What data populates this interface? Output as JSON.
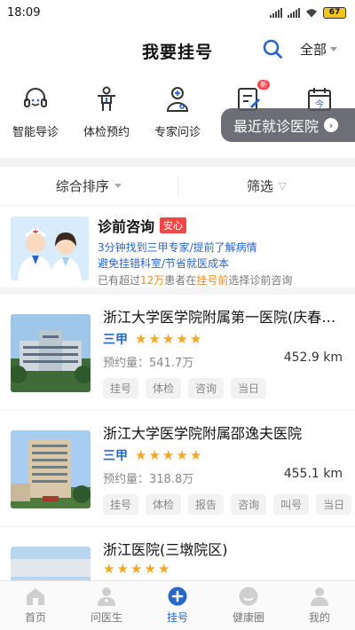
{
  "status_bar": {
    "time": "18:09",
    "battery": "67"
  },
  "header": {
    "title": "我要挂号",
    "city": "全部"
  },
  "quick_entries": [
    {
      "label": "智能导诊",
      "icon": "headset-icon"
    },
    {
      "label": "体检预约",
      "icon": "person-icon"
    },
    {
      "label": "专家问诊",
      "icon": "doctor-stethoscope-icon"
    },
    {
      "label": "",
      "icon": "clipboard-edit-icon",
      "badge": "新"
    },
    {
      "label": "",
      "icon": "calendar-icon",
      "icon_text": "今"
    }
  ],
  "recent_hospital_label": "最近就诊医院",
  "recent_hospital_arrow": "›",
  "sort_bar": {
    "sort_label": "综合排序",
    "filter_label": "筛选",
    "filter_icon": "▽"
  },
  "consult_card": {
    "title": "诊前咨询",
    "tag": "安心",
    "line1": "3分钟找到三甲专家/提前了解病情",
    "line2": "避免挂错科室/节省就医成本",
    "note_prefix": "已有超过",
    "note_count": "12万",
    "note_mid": "患者在",
    "note_highlight": "挂号前",
    "note_suffix": "选择诊前咨询"
  },
  "hospitals": [
    {
      "name": "浙江大学医学院附属第一医院(庆春院区)",
      "level": "三甲",
      "rating_stars": 5,
      "volume": "预约量：541.7万",
      "distance": "452.9 km",
      "tags": [
        "挂号",
        "体检",
        "咨询",
        "当日"
      ]
    },
    {
      "name": "浙江大学医学院附属邵逸夫医院",
      "level": "三甲",
      "rating_stars": 5,
      "volume": "预约量：318.8万",
      "distance": "455.1 km",
      "tags": [
        "挂号",
        "体检",
        "报告",
        "咨询",
        "叫号",
        "当日"
      ]
    },
    {
      "name": "浙江医院(三墩院区)",
      "level": "",
      "rating_stars": 5,
      "volume": "",
      "distance": "",
      "tags": []
    }
  ],
  "bottom_nav": [
    {
      "label": "首页",
      "icon": "home-icon",
      "active": false
    },
    {
      "label": "问医生",
      "icon": "doctor-icon",
      "active": false
    },
    {
      "label": "挂号",
      "icon": "plus-circle-icon",
      "active": true
    },
    {
      "label": "健康圈",
      "icon": "chat-circle-icon",
      "active": false
    },
    {
      "label": "我的",
      "icon": "user-icon",
      "active": false
    }
  ],
  "colors": {
    "accent": "#2a66c8",
    "star": "#f5a623",
    "warning": "#f04848",
    "highlight": "#ee8c1c"
  }
}
